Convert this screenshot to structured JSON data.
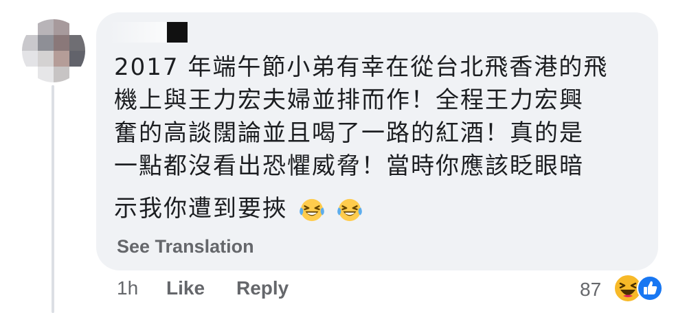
{
  "comment": {
    "lines": [
      "2017 年端午節小弟有幸在從台北飛香港的飛",
      "機上與王力宏夫婦並排而作！全程王力宏興",
      "奮的高談闊論並且喝了一路的紅酒！真的是",
      "一點都沒看出恐懼威脅！當時你應該眨眼暗",
      "示我你遭到要挾"
    ],
    "trailing_emojis": [
      "laughing-tears-emoji",
      "laughing-tears-emoji"
    ],
    "see_translation": "See Translation"
  },
  "actions": {
    "time": "1h",
    "like": "Like",
    "reply": "Reply"
  },
  "reactions": {
    "count": "87",
    "icons": [
      "haha-reaction-icon",
      "like-reaction-icon"
    ]
  },
  "colors": {
    "bubble_bg": "#f0f2f5",
    "text": "#1c1e21",
    "secondary": "#65676b",
    "like_blue": "#1877f2",
    "haha_yellow": "#f7b928"
  }
}
